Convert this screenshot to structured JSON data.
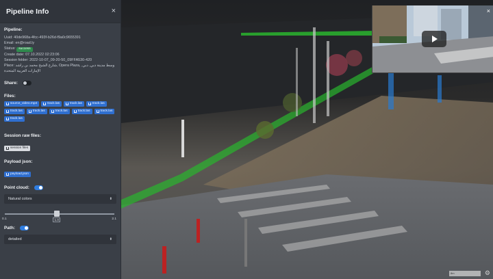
{
  "panel": {
    "title": "Pipeline Info",
    "close": "×",
    "pipeline_title": "Pipeline:",
    "uuid": "Uuid: 40de968a-4fcc-493f-b26d-f9a0c9655391",
    "email": "Email: en@road.ly",
    "status_label": "Status:",
    "status_value": "success",
    "create_date": "Create date: 07.10.2022 02:23:06",
    "session_folder": "Session folder: 2022-10-07_09-20-50_09FFA530-420",
    "place": "Place: شارع الشيخ محمد بن راشد, Opera Plaza, وسط مدينة دبي, دبي, الإمارات العربية المتحدة",
    "share_label": "Share:",
    "files_label": "Files:",
    "files": [
      "source_video.mp4",
      "track.las",
      "track.las",
      "track.las",
      "track.las",
      "track.las",
      "track.las",
      "track.las",
      "track.las",
      "track.las"
    ],
    "session_raw_label": "Session raw files:",
    "session_files_btn": "session files",
    "payload_label": "Payload json:",
    "payload_btn": "payload.json",
    "point_cloud_label": "Point cloud:",
    "point_cloud_select": "Natural colors",
    "slider": {
      "min": "0.1",
      "max": "2.1",
      "value": "1.0",
      "level": 0.45
    },
    "path_label": "Path:",
    "path_select": "detailed"
  },
  "viewport": {
    "video_close": "×",
    "scale_text": "8m",
    "colors": {
      "path_green": "#27b52b",
      "panel_bg": "#3a3f47",
      "chip_blue": "#2f6fd0",
      "success": "#2f8a4d"
    }
  }
}
